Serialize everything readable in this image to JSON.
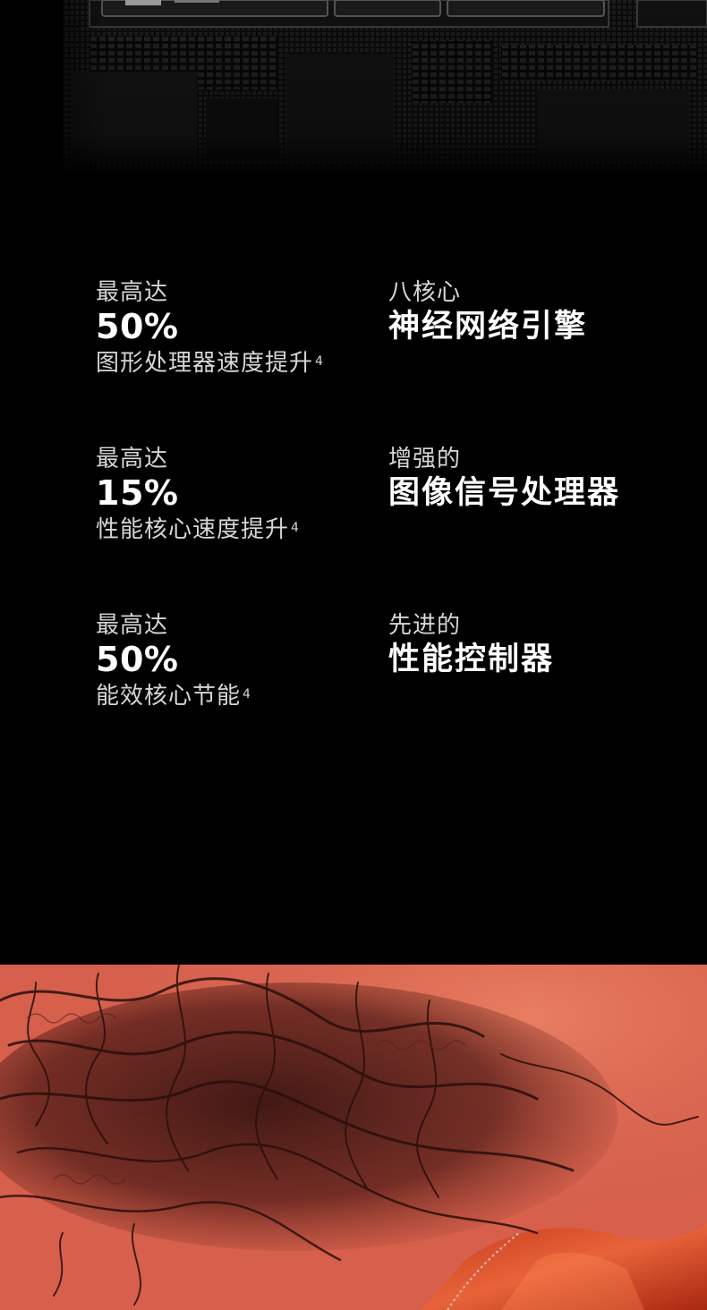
{
  "specs": [
    {
      "pre": "最高达",
      "main": "50%",
      "desc": "图形处理器速度提升",
      "note": "4"
    },
    {
      "pre": "八核心",
      "main": "神经网络引擎"
    },
    {
      "pre": "最高达",
      "main": "15%",
      "desc": "性能核心速度提升",
      "note": "4"
    },
    {
      "pre": "增强的",
      "main": "图像信号处理器"
    },
    {
      "pre": "最高达",
      "main": "50%",
      "desc": "能效核心节能",
      "note": "4"
    },
    {
      "pre": "先进的",
      "main": "性能控制器"
    }
  ],
  "colors": {
    "background": "#000000",
    "secondary_text": "#d6d6d6",
    "photo_tone": "#d8614f"
  }
}
